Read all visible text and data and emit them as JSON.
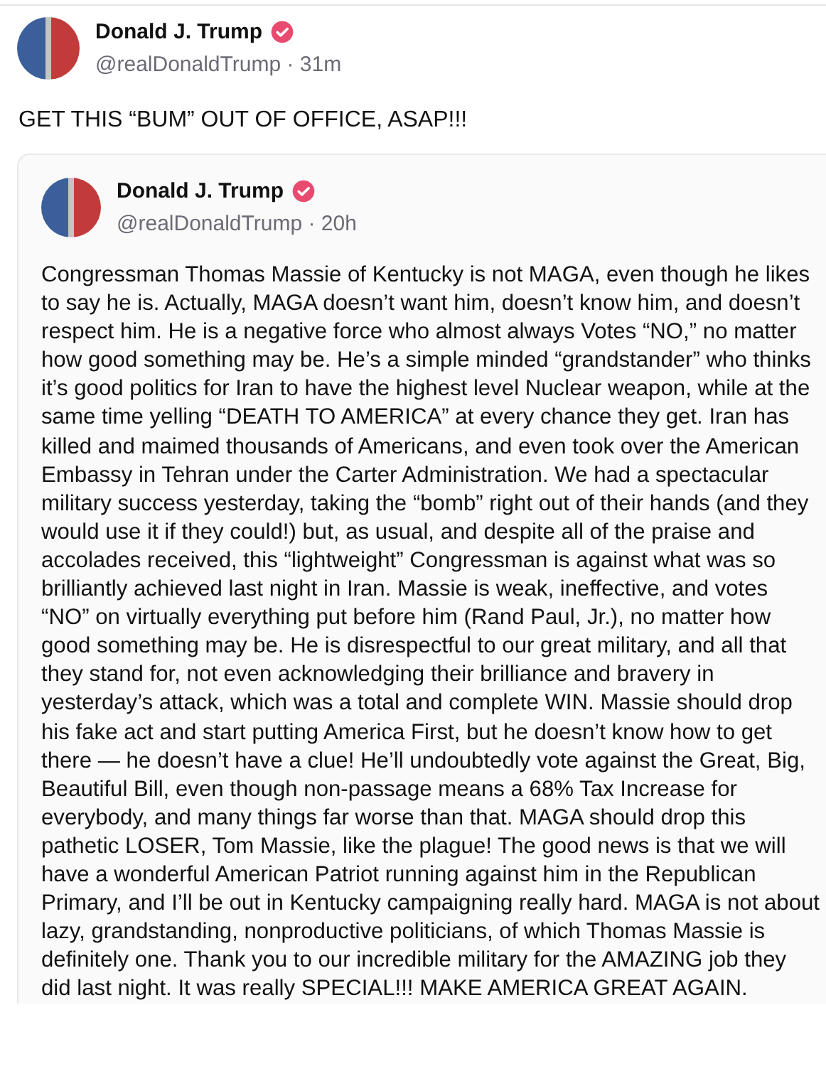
{
  "post": {
    "author": "Donald J. Trump",
    "verified": true,
    "meta": "@realDonaldTrump · 31m",
    "text": "GET THIS “BUM” OUT OF OFFICE, ASAP!!!",
    "quoted": {
      "author": "Donald J. Trump",
      "verified": true,
      "meta": "@realDonaldTrump · 20h",
      "text": "Congressman Thomas Massie of Kentucky is not MAGA, even though he likes to say he is. Actually, MAGA doesn’t want him, doesn’t know him, and doesn’t respect him. He is a negative force who almost always Votes “NO,” no matter how good something may be. He’s a simple minded “grandstander” who thinks it’s good politics for Iran to have the highest level Nuclear weapon, while at the same time yelling “DEATH TO AMERICA” at every chance they get. Iran has killed and maimed thousands of Americans, and even took over the American Embassy in Tehran under the Carter Administration. We had a spectacular military success yesterday, taking the “bomb” right out of their hands (and they would use it if they could!) but, as usual, and despite all of the praise and accolades received, this “lightweight” Congressman is against what was so brilliantly achieved last night in Iran. Massie is weak, ineffective, and votes “NO” on virtually everything put before him (Rand Paul, Jr.), no matter how good something may be. He is disrespectful to our great military, and all that they stand for, not even acknowledging their brilliance and bravery in yesterday’s attack, which was a total and complete WIN. Massie should drop his fake act and start putting America First, but he doesn’t know how to get there — he doesn’t have a clue! He’ll undoubtedly vote against the Great, Big, Beautiful Bill, even though non-passage means a 68% Tax Increase for everybody, and many things far worse than that. MAGA should drop this pathetic LOSER, Tom Massie, like the plague! The good news is that we will have a wonderful American Patriot running against him in the Republican Primary, and I’ll be out in Kentucky campaigning really hard. MAGA is not about lazy, grandstanding, nonproductive politicians, of which Thomas Massie is definitely one. Thank you to our incredible military for the AMAZING job they did last night. It was really SPECIAL!!! MAKE AMERICA GREAT AGAIN."
    }
  }
}
